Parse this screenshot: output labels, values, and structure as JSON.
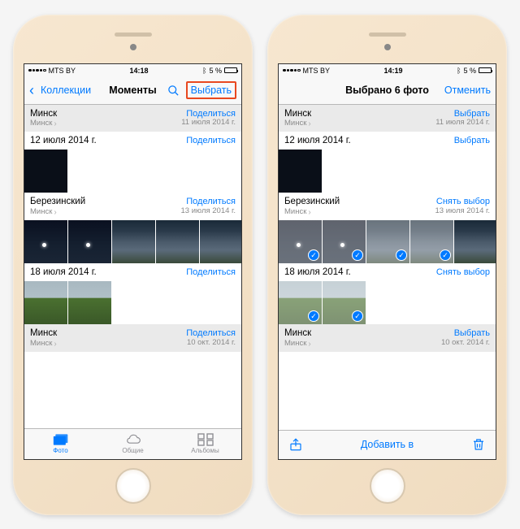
{
  "colors": {
    "accent": "#007aff",
    "highlight": "#e8481f"
  },
  "left": {
    "status": {
      "carrier": "MTS BY",
      "time": "14:18",
      "battery": "5 %"
    },
    "nav": {
      "back": "Коллекции",
      "title": "Моменты",
      "select": "Выбрать"
    },
    "sections": [
      {
        "title": "Минск",
        "sub": "Минск",
        "action": "Поделиться",
        "date": "11 июля 2014 г.",
        "gray": true,
        "thumbs": []
      },
      {
        "title": "12 июля 2014 г.",
        "sub": "",
        "action": "Поделиться",
        "date": "",
        "thumbs": [
          "dark"
        ]
      },
      {
        "title": "Березинский",
        "sub": "Минск",
        "action": "Поделиться",
        "date": "13 июля 2014 г.",
        "thumbs": [
          "night",
          "night",
          "sky",
          "sky",
          "sky"
        ]
      },
      {
        "title": "18 июля 2014 г.",
        "sub": "",
        "action": "Поделиться",
        "date": "",
        "thumbs": [
          "field",
          "field"
        ]
      },
      {
        "title": "Минск",
        "sub": "Минск",
        "action": "Поделиться",
        "date": "10 окт. 2014 г.",
        "gray": true,
        "thumbs": []
      }
    ],
    "tabs": [
      {
        "label": "Фото",
        "icon": "photos",
        "active": true
      },
      {
        "label": "Общие",
        "icon": "cloud",
        "active": false
      },
      {
        "label": "Альбомы",
        "icon": "albums",
        "active": false
      }
    ]
  },
  "right": {
    "status": {
      "carrier": "MTS BY",
      "time": "14:19",
      "battery": "5 %"
    },
    "nav": {
      "title": "Выбрано 6 фото",
      "cancel": "Отменить"
    },
    "sections": [
      {
        "title": "Минск",
        "sub": "Минск",
        "action": "Выбрать",
        "date": "11 июля 2014 г.",
        "gray": true,
        "thumbs": []
      },
      {
        "title": "12 июля 2014 г.",
        "sub": "",
        "action": "Выбрать",
        "date": "",
        "thumbs": [
          "dark"
        ],
        "selected": []
      },
      {
        "title": "Березинский",
        "sub": "Минск",
        "action": "Снять выбор",
        "date": "13 июля 2014 г.",
        "thumbs": [
          "night",
          "night",
          "sky",
          "sky",
          "sky"
        ],
        "selected": [
          0,
          1,
          2,
          3
        ]
      },
      {
        "title": "18 июля 2014 г.",
        "sub": "",
        "action": "Снять выбор",
        "date": "",
        "thumbs": [
          "field",
          "field"
        ],
        "selected": [
          0,
          1
        ]
      },
      {
        "title": "Минск",
        "sub": "Минск",
        "action": "Выбрать",
        "date": "10 окт. 2014 г.",
        "gray": true,
        "thumbs": []
      }
    ],
    "toolbar": {
      "center": "Добавить в"
    }
  }
}
